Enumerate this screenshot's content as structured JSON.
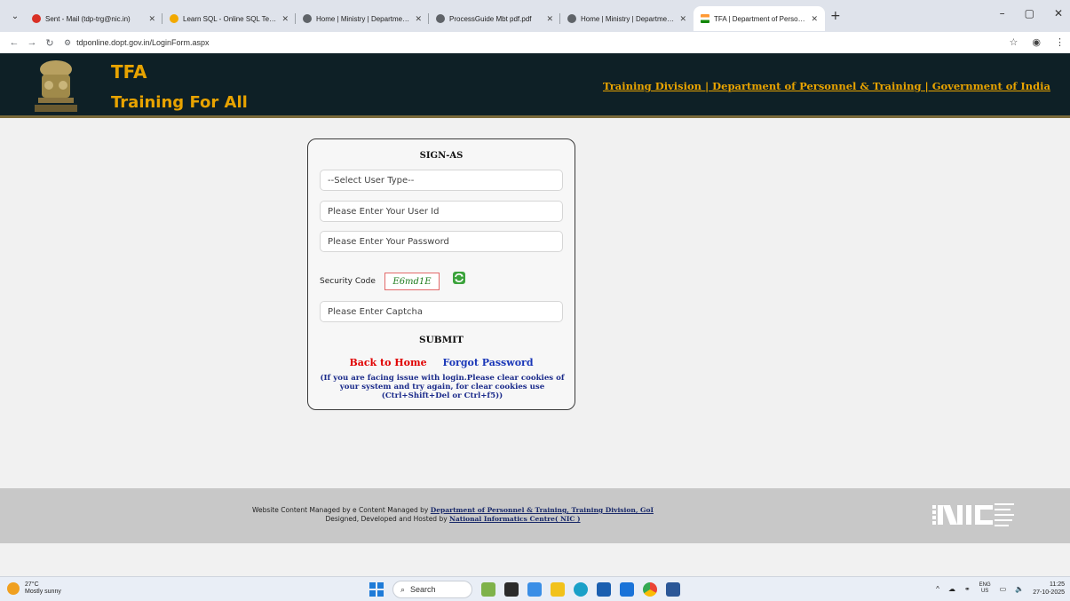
{
  "browser": {
    "tabs": [
      {
        "title": "Sent - Mail (tdp-trg@nic.in)",
        "color": "#d93025"
      },
      {
        "title": "Learn SQL - Online SQL Termina",
        "color": "#f2a900"
      },
      {
        "title": "Home | Ministry | Department |",
        "color": "#5f6368"
      },
      {
        "title": "ProcessGuide Mbt pdf.pdf",
        "color": "#5f6368"
      },
      {
        "title": "Home | Ministry | Department |",
        "color": "#5f6368"
      },
      {
        "title": "TFA | Department of Personnel",
        "color": "#ff9933"
      }
    ],
    "url": "tdponline.dopt.gov.in/LoginForm.aspx"
  },
  "header": {
    "title": "TFA",
    "subtitle": "Training For All",
    "link": "Training Division | Department of Personnel & Training | Government of India"
  },
  "login": {
    "heading": "SIGN-AS",
    "user_type": "--Select User Type--",
    "userid_placeholder": "Please Enter Your User Id",
    "password_placeholder": "Please Enter Your Password",
    "security_label": "Security Code",
    "captcha": "E6md1E",
    "captcha_placeholder": "Please Enter Captcha",
    "submit": "SUBMIT",
    "back_home": "Back to Home",
    "forgot": "Forgot Password",
    "note": "(If you are facing issue with login.Please clear cookies of your system and try again, for clear cookies use (Ctrl+Shift+Del or Ctrl+f5))"
  },
  "footer": {
    "line1_prefix": "Website Content Managed by e Content Managed by",
    "line1_link": "Department of Personnel & Training, Training Division, GoI",
    "line2_prefix": "Designed, Developed and Hosted by",
    "line2_link": "National Informatics Centre( NIC )"
  },
  "taskbar": {
    "temp": "27°C",
    "weather": "Mostly sunny",
    "search": "Search",
    "lang1": "ENG",
    "lang2": "US",
    "time": "11:25",
    "date": "27-10-2025"
  }
}
